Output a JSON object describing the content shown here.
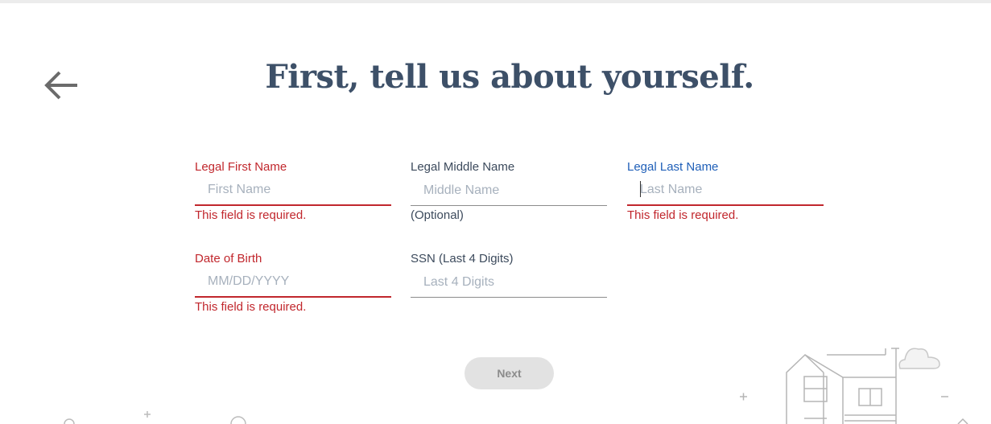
{
  "page": {
    "title": "First, tell us about yourself."
  },
  "form": {
    "first_name": {
      "label": "Legal First Name",
      "placeholder": "First Name",
      "message": "This field is required."
    },
    "middle_name": {
      "label": "Legal Middle Name",
      "placeholder": "Middle Name",
      "message": "(Optional)"
    },
    "last_name": {
      "label": "Legal Last Name",
      "placeholder": "Last Name",
      "message": "This field is required."
    },
    "dob": {
      "label": "Date of Birth",
      "placeholder": "MM/DD/YYYY",
      "message": "This field is required."
    },
    "ssn": {
      "label": "SSN (Last 4 Digits)",
      "placeholder": "Last 4 Digits"
    }
  },
  "actions": {
    "next_label": "Next"
  },
  "icons": {
    "back": "arrow-left-icon"
  },
  "colors": {
    "title": "#3d5068",
    "error": "#c1272d",
    "focus": "#1f5fb8",
    "button_bg": "#e2e2e2"
  }
}
